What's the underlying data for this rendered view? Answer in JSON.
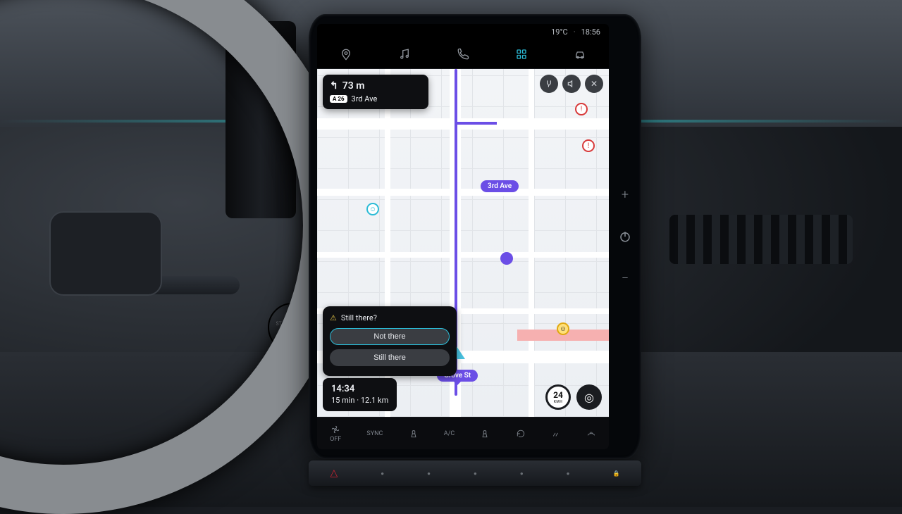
{
  "status": {
    "temperature": "19°C",
    "time": "18:56"
  },
  "nav_icons": [
    "location",
    "music",
    "phone",
    "apps",
    "car"
  ],
  "turn": {
    "distance": "73 m",
    "road_badge": "A 26",
    "street": "3rd Ave"
  },
  "map": {
    "current_street": "3rd Ave",
    "dest_street": "Grove St"
  },
  "prompt": {
    "question": "Still there?",
    "options": [
      "Not there",
      "Still there"
    ]
  },
  "eta": {
    "arrival": "14:34",
    "duration": "15 min",
    "distance": "12.1 km"
  },
  "speed": {
    "value": "24",
    "unit": "KMH"
  },
  "climate": {
    "off_label": "OFF",
    "sync_label": "SYNC",
    "ac_label": "A/C"
  },
  "start_button": "START\nENGINE\nSTOP"
}
